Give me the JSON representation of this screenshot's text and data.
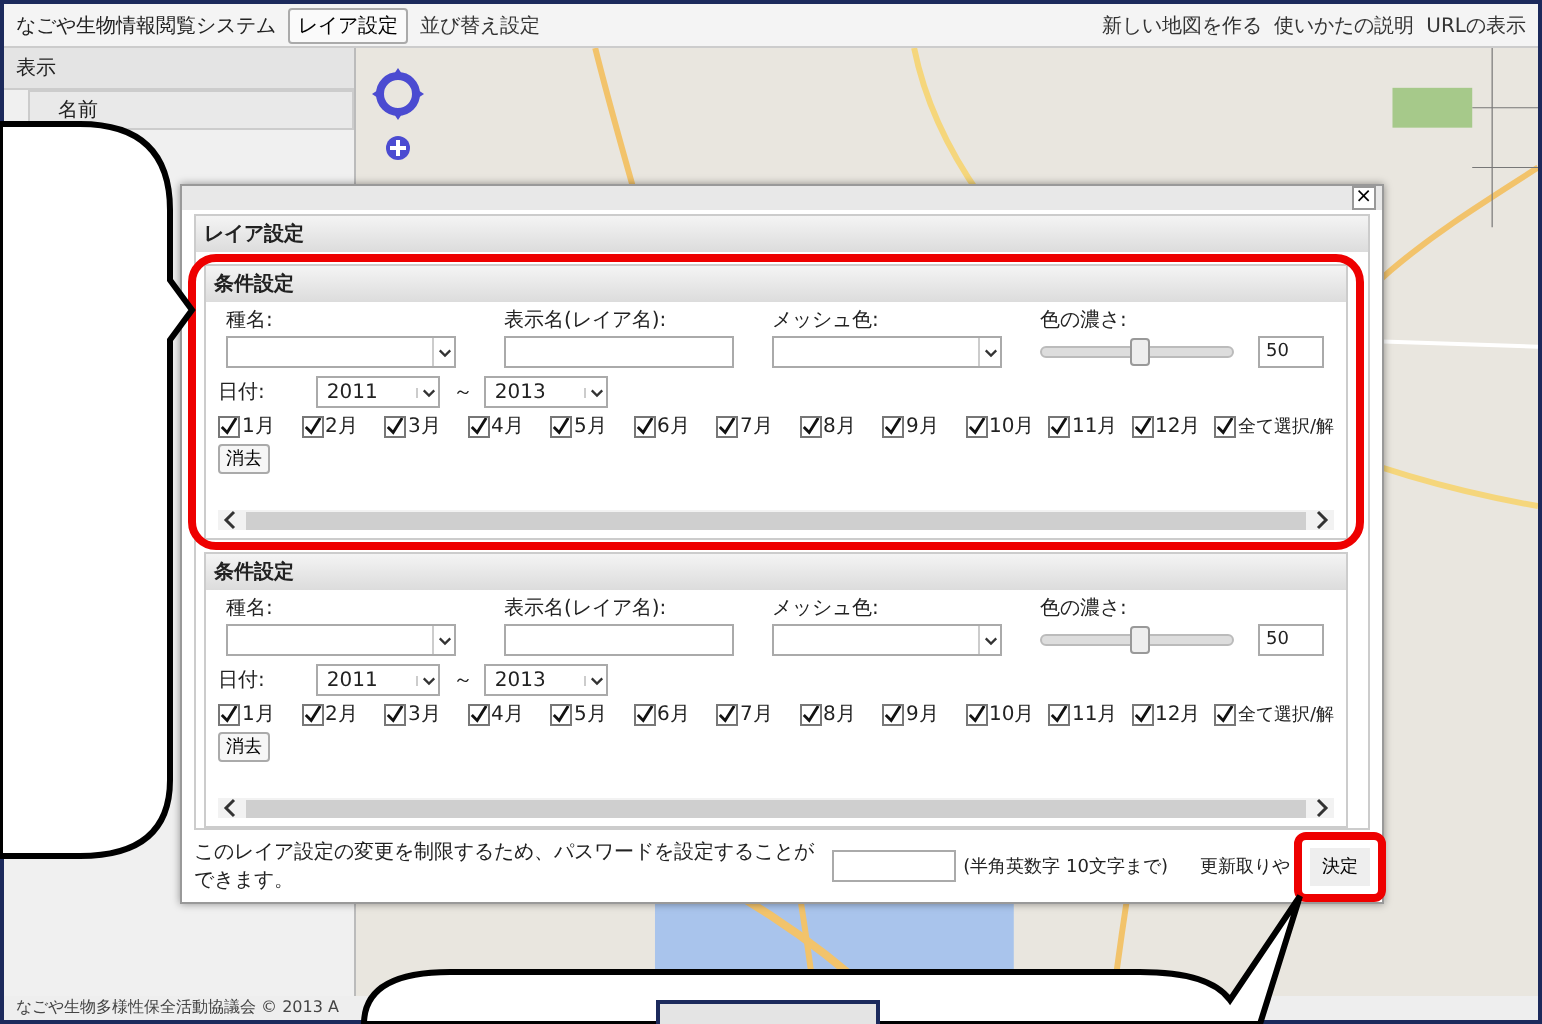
{
  "app": {
    "title": "なごや生物情報閲覧システム",
    "toolbar": [
      {
        "label": "レイア設定",
        "kind": "button"
      },
      {
        "label": "並び替え設定",
        "kind": "link"
      }
    ],
    "links": [
      "新しい地図を作る",
      "使いかたの説明",
      "URLの表示"
    ]
  },
  "sidebar": {
    "title": "表示",
    "column": "名前"
  },
  "footer": "なごや生物多様性保全活動協議会 © 2013 A",
  "dialog": {
    "close": "×",
    "panel_title": "レイア設定",
    "sections": [
      {
        "title": "条件設定",
        "highlighted": true,
        "fields": [
          {
            "label": "種名:",
            "kind": "select"
          },
          {
            "label": "表示名(レイア名):",
            "kind": "text"
          },
          {
            "label": "メッシュ色:",
            "kind": "select"
          },
          {
            "label": "色の濃さ:",
            "kind": "slider",
            "level": 0.5,
            "value": "50"
          }
        ],
        "date_label": "日付:",
        "from": "2011",
        "separator": "～",
        "to": "2013",
        "months": [
          {
            "label": "1月",
            "checked": true
          },
          {
            "label": "2月",
            "checked": true
          },
          {
            "label": "3月",
            "checked": true
          },
          {
            "label": "4月",
            "checked": true
          },
          {
            "label": "5月",
            "checked": true
          },
          {
            "label": "6月",
            "checked": true
          },
          {
            "label": "7月",
            "checked": true
          },
          {
            "label": "8月",
            "checked": true
          },
          {
            "label": "9月",
            "checked": true
          },
          {
            "label": "10月",
            "checked": true
          },
          {
            "label": "11月",
            "checked": true
          },
          {
            "label": "12月",
            "checked": true
          }
        ],
        "all": {
          "label": "全て選択/解",
          "checked": true
        },
        "clear": "消去"
      },
      {
        "title": "条件設定",
        "highlighted": false,
        "fields": [
          {
            "label": "種名:",
            "kind": "select"
          },
          {
            "label": "表示名(レイア名):",
            "kind": "text"
          },
          {
            "label": "メッシュ色:",
            "kind": "select"
          },
          {
            "label": "色の濃さ:",
            "kind": "slider",
            "level": 0.5,
            "value": "50"
          }
        ],
        "date_label": "日付:",
        "from": "2011",
        "separator": "～",
        "to": "2013",
        "months": [
          {
            "label": "1月",
            "checked": true
          },
          {
            "label": "2月",
            "checked": true
          },
          {
            "label": "3月",
            "checked": true
          },
          {
            "label": "4月",
            "checked": true
          },
          {
            "label": "5月",
            "checked": true
          },
          {
            "label": "6月",
            "checked": true
          },
          {
            "label": "7月",
            "checked": true
          },
          {
            "label": "8月",
            "checked": true
          },
          {
            "label": "9月",
            "checked": true
          },
          {
            "label": "10月",
            "checked": true
          },
          {
            "label": "11月",
            "checked": true
          },
          {
            "label": "12月",
            "checked": true
          }
        ],
        "all": {
          "label": "全て選択/解",
          "checked": true
        },
        "clear": "消去"
      }
    ],
    "password_note": "このレイア設定の変更を制限するため、パスワードを設定することができます。",
    "password_hint": "(半角英数字 10文字まで)",
    "cancel": "更新取りや",
    "confirm": {
      "label": "決定",
      "highlighted": true
    }
  }
}
